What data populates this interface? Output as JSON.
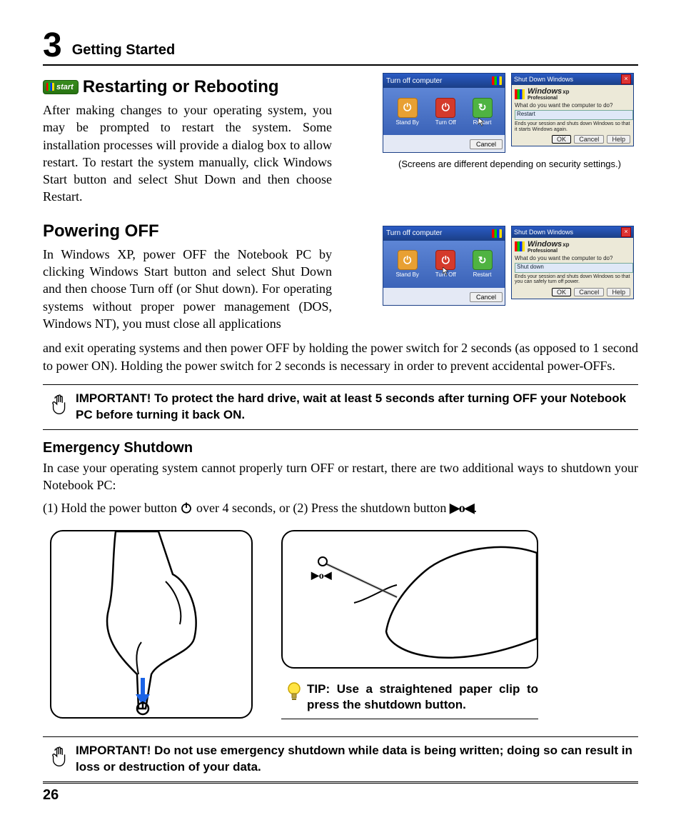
{
  "chapter": {
    "number": "3",
    "title": "Getting Started"
  },
  "start_badge": "start",
  "section1": {
    "heading": "Restarting or Rebooting",
    "body": "After making changes to your operating system, you may be prompted to restart the system. Some installation processes will provide a dialog box to allow restart. To restart the system manually, click Windows Start button and select Shut Down and then choose Restart."
  },
  "screens_caption": "(Screens are different depending on security settings.)",
  "turnoff_dialog": {
    "title": "Turn off computer",
    "opts": [
      "Stand By",
      "Turn Off",
      "Restart"
    ],
    "cancel": "Cancel"
  },
  "shutdown_dialog": {
    "title": "Shut Down Windows",
    "brand1": "Windows",
    "brand2": "xp",
    "brand3": "Professional",
    "q1": "What do you want the computer to do?",
    "sel1": "Restart",
    "desc1": "Ends your session and shuts down Windows so that it starts Windows again.",
    "sel2": "Shut down",
    "desc2": "Ends your session and shuts down Windows so that you can safely turn off power.",
    "ok": "OK",
    "cancel": "Cancel",
    "help": "Help"
  },
  "section2": {
    "heading": "Powering OFF",
    "body_a": "In Windows XP, power OFF the Notebook PC by clicking Windows Start button and select Shut Down and then choose Turn off (or Shut down). For oper­ating systems without proper power management (DOS, Windows NT), you must close all applications",
    "body_b": "and exit operating systems and then power OFF by holding the power switch for 2 seconds (as opposed to 1 second to power ON). Holding the power switch for 2 seconds is necessary in order to prevent ac­cidental power-OFFs."
  },
  "important1": "IMPORTANT!  To protect the hard drive, wait at least 5 seconds after turning OFF your Notebook PC before turning it back ON.",
  "section3": {
    "heading": "Emergency Shutdown",
    "body": "In case your operating system cannot properly turn OFF or restart, there are two additional ways to shutdown your Notebook PC:",
    "step1a": "(1) Hold the power button ",
    "step1b": " over 4 seconds, or  (2) Press the shutdown button ",
    "step1c": "."
  },
  "tip": "TIP: Use a straightened paper clip to press the shutdown button.",
  "important2": "IMPORTANT!  Do not use emergency shutdown while data is being written; doing so can result in loss or destruction of your data.",
  "page_number": "26"
}
